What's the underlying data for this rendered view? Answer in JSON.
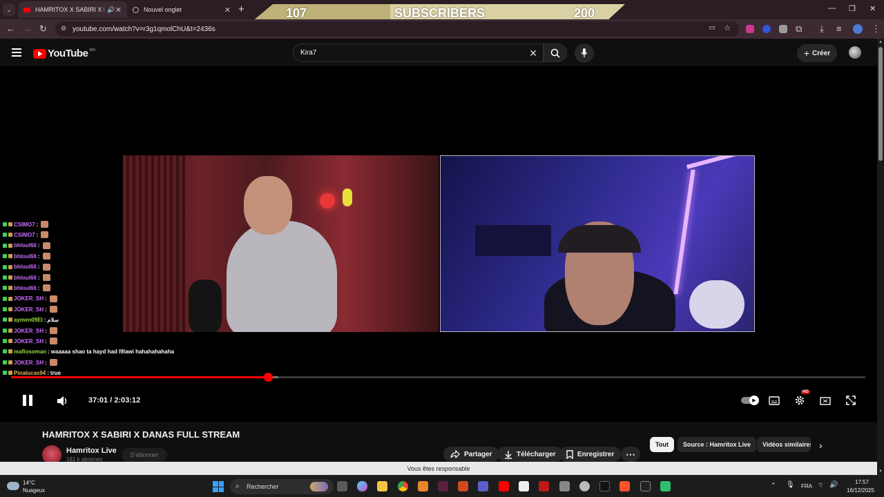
{
  "browser": {
    "tabs": [
      {
        "title": "HAMRITOX X SABIRI X DAN",
        "active": true
      },
      {
        "title": "Nouvel onglet",
        "active": false
      }
    ],
    "url": "youtube.com/watch?v=r3g1qmolChU&t=2436s"
  },
  "overlay": {
    "current": "107",
    "label": "SUBSCRIBERS",
    "goal": "200"
  },
  "youtube": {
    "logo_text": "YouTube",
    "country_code": "MA",
    "search_value": "Kira7",
    "create_label": "Créer"
  },
  "chat": [
    {
      "user": "CSIMO7",
      "color": "#c86cff",
      "msg": ""
    },
    {
      "user": "CSIMO7",
      "color": "#c86cff",
      "msg": ""
    },
    {
      "user": "bhloul66",
      "color": "#c86cff",
      "msg": ""
    },
    {
      "user": "bhloul66",
      "color": "#c86cff",
      "msg": ""
    },
    {
      "user": "bhloul66",
      "color": "#c86cff",
      "msg": ""
    },
    {
      "user": "bhloul66",
      "color": "#c86cff",
      "msg": ""
    },
    {
      "user": "bhloul66",
      "color": "#c86cff",
      "msg": ""
    },
    {
      "user": "JOKER_SH",
      "color": "#c86cff",
      "msg": ""
    },
    {
      "user": "JOKER_SH",
      "color": "#c86cff",
      "msg": ""
    },
    {
      "user": "aymen09El",
      "color": "#9bd84a",
      "msg": "سلام"
    },
    {
      "user": "JOKER_SH",
      "color": "#c86cff",
      "msg": ""
    },
    {
      "user": "JOKER_SH",
      "color": "#c86cff",
      "msg": ""
    },
    {
      "user": "mafiosoman",
      "color": "#9bd84a",
      "msg": "waaaaa shao ta hayd had l9lawi hahahahahaha"
    },
    {
      "user": "JOKER_SH",
      "color": "#c86cff",
      "msg": ""
    },
    {
      "user": "Pinalucas94",
      "color": "#e6b35a",
      "msg": "true"
    }
  ],
  "player": {
    "time_current": "37:01",
    "time_total": "2:03:12",
    "progress": 0.301,
    "buffered": 0.313,
    "quality_badge": "HD"
  },
  "video": {
    "title": "HAMRITOX X SABIRI X DANAS FULL STREAM",
    "channel": "Hamritox Live",
    "subscribers": "181 k abonnés",
    "subscribe_label": "S'abonner",
    "actions": [
      "Partager",
      "Télécharger",
      "Enregistrer"
    ],
    "chips": [
      "Tout",
      "Source : Hamritox Live",
      "Vidéos similaires"
    ]
  },
  "notice": "Vous êtes responsable",
  "taskbar": {
    "temperature": "14°C",
    "weather": "Nuageux",
    "search_placeholder": "Rechercher",
    "language": "FRA",
    "time": "17:57",
    "date": "16/12/2025"
  }
}
